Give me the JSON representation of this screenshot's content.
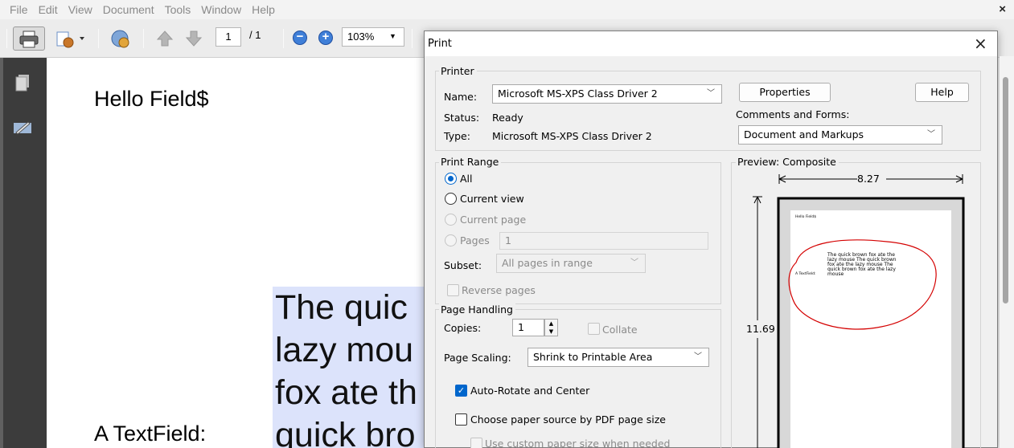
{
  "menubar": {
    "items": [
      "File",
      "Edit",
      "View",
      "Document",
      "Tools",
      "Window",
      "Help"
    ],
    "close_glyph": "×"
  },
  "toolbar": {
    "page_current": "1",
    "page_total": "/ 1",
    "zoom": "103%",
    "icons": [
      "print-icon",
      "create-pdf-icon",
      "collaborate-icon",
      "previous-page-icon",
      "next-page-icon",
      "zoom-out-icon",
      "zoom-in-icon"
    ]
  },
  "document": {
    "hello": "Hello Field$",
    "textfield_label": "A TextField:",
    "text_lines": [
      "The quic",
      "lazy mou",
      "fox ate th",
      "quick bro"
    ]
  },
  "dialog": {
    "title": "Print",
    "close_glyph": "×",
    "printer": {
      "legend": "Printer",
      "name_label": "Name:",
      "name_value": "Microsoft MS-XPS Class Driver 2",
      "status_label": "Status:",
      "status_value": "Ready",
      "type_label": "Type:",
      "type_value": "Microsoft MS-XPS Class Driver 2",
      "properties_button": "Properties",
      "help_button": "Help",
      "comments_label": "Comments and Forms:",
      "comments_value": "Document and Markups"
    },
    "print_range": {
      "legend": "Print Range",
      "all": "All",
      "current_view": "Current view",
      "current_page": "Current page",
      "pages": "Pages",
      "pages_value": "1",
      "subset_label": "Subset:",
      "subset_value": "All pages in range",
      "reverse_pages": "Reverse pages",
      "selected": "All"
    },
    "page_handling": {
      "legend": "Page Handling",
      "copies_label": "Copies:",
      "copies_value": "1",
      "collate": "Collate",
      "scaling_label": "Page Scaling:",
      "scaling_value": "Shrink to Printable Area",
      "auto_rotate": "Auto-Rotate and Center",
      "auto_rotate_checked": true,
      "choose_paper": "Choose paper source by PDF page size",
      "custom_paper": "Use custom paper size when needed"
    },
    "preview": {
      "legend": "Preview: Composite",
      "width": "8.27",
      "height": "11.69",
      "mini_hello": "Hello Field$",
      "mini_label": "A TextField:",
      "mini_lines": [
        "The quick brown fox ate the",
        "lazy mouse The quick brown",
        "fox ate the lazy mouse The",
        "quick brown fox ate the lazy",
        "mouse"
      ]
    }
  },
  "colors": {
    "accent": "#0066cc",
    "text_highlight": "#dce3fb",
    "annotation": "#d40000"
  }
}
